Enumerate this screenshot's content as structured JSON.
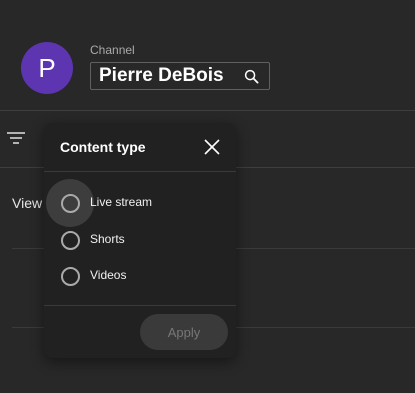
{
  "channel": {
    "avatar_letter": "P",
    "label": "Channel",
    "name": "Pierre DeBois",
    "avatar_color": "#5e35b1"
  },
  "list": {
    "view_text": "View"
  },
  "popup": {
    "title": "Content type",
    "options": [
      {
        "label": "Live stream",
        "selected": false,
        "hovered": true
      },
      {
        "label": "Shorts",
        "selected": false
      },
      {
        "label": "Videos",
        "selected": false
      }
    ],
    "apply_label": "Apply",
    "apply_enabled": false
  },
  "icons": {
    "search": "search-icon",
    "filter": "filter-icon",
    "close": "close-icon"
  }
}
